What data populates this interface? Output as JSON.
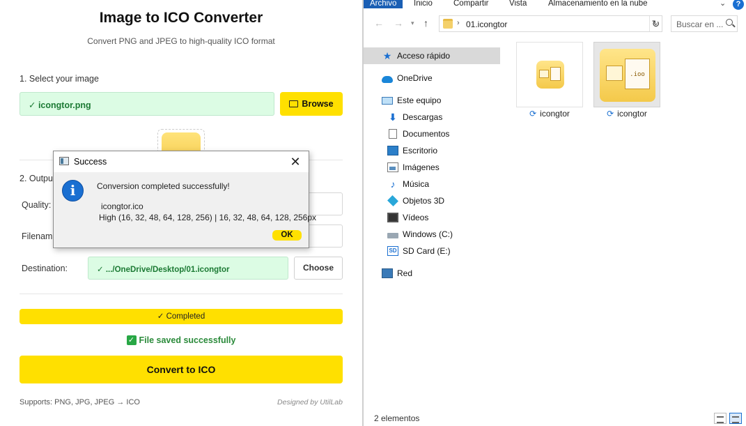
{
  "app": {
    "title": "Image to ICO Converter",
    "subtitle": "Convert PNG and JPEG to high-quality ICO format",
    "step1_label": "1. Select your image",
    "selected_file": "✓ icongtor.png",
    "browse_label": "Browse",
    "step2_label": "2. Output",
    "quality_label": "Quality:",
    "filename_label": "Filename",
    "destination_label": "Destination:",
    "destination_value": "✓ .../OneDrive/Desktop/01.icongtor",
    "choose_label": "Choose",
    "progress_label": "✓ Completed",
    "progress_fraction": 1.0,
    "saved_check": "✓",
    "saved_label": "File saved successfully",
    "convert_label": "Convert to ICO",
    "supports_label": "Supports: PNG, JPG, JPEG → ICO",
    "designed_by": "Designed by UtilLab",
    "accent_color": "#ffe000",
    "success_color": "#dcfce4"
  },
  "dialog": {
    "title": "Success",
    "info_glyph": "i",
    "close_glyph": "✕",
    "message": "Conversion completed successfully!",
    "file_name": "icongtor.ico",
    "sizes": "High (16, 32, 48, 64, 128, 256) |  16, 32, 48, 64, 128, 256px",
    "ok_label": "OK"
  },
  "explorer": {
    "ribbon_tabs": [
      "Archivo",
      "Inicio",
      "Compartir",
      "Vista",
      "Almacenamiento en la nube"
    ],
    "help_glyph": "?",
    "address_path": "01.icongtor",
    "search_placeholder": "Buscar en ...",
    "nav_items": [
      {
        "label": "Acceso rápido",
        "icon": "quick-access-icon"
      },
      {
        "label": "OneDrive",
        "icon": "onedrive-icon"
      },
      {
        "label": "Este equipo",
        "icon": "this-pc-icon"
      },
      {
        "label": "Descargas",
        "icon": "downloads-icon"
      },
      {
        "label": "Documentos",
        "icon": "documents-icon"
      },
      {
        "label": "Escritorio",
        "icon": "desktop-icon"
      },
      {
        "label": "Imágenes",
        "icon": "pictures-icon"
      },
      {
        "label": "Música",
        "icon": "music-icon"
      },
      {
        "label": "Objetos 3D",
        "icon": "3d-objects-icon"
      },
      {
        "label": "Vídeos",
        "icon": "videos-icon"
      },
      {
        "label": "Windows (C:)",
        "icon": "drive-icon"
      },
      {
        "label": "SD Card (E:)",
        "icon": "sd-card-icon"
      },
      {
        "label": "Red",
        "icon": "network-icon"
      }
    ],
    "files": [
      {
        "name": "icongtor",
        "icon": "png-file-icon"
      },
      {
        "name": "icongtor",
        "icon": "ico-file-icon"
      }
    ],
    "ico_label": ".ioo",
    "status": "2 elementos"
  }
}
